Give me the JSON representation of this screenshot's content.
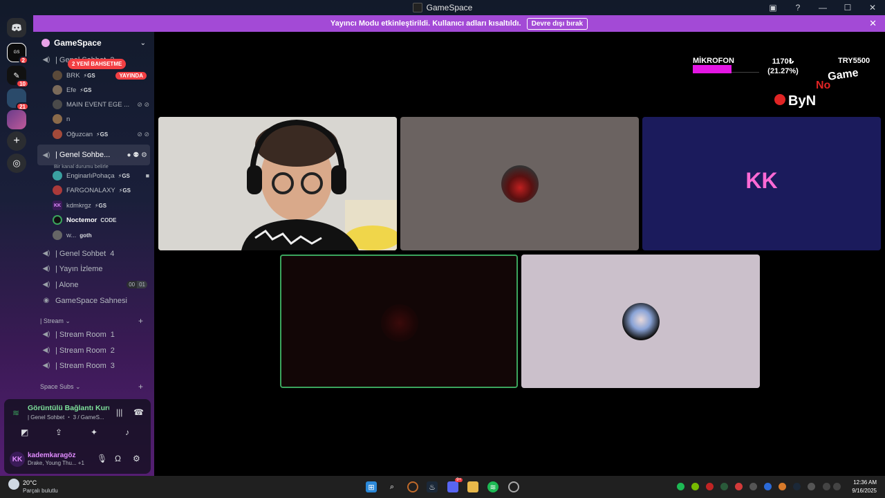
{
  "window": {
    "title": "GameSpace"
  },
  "banner": {
    "text": "Yayıncı Modu etkinleştirildi. Kullanıcı adları kısaltıldı.",
    "button": "Devre dışı bırak"
  },
  "rail": {
    "badges": [
      "2",
      "10",
      "21"
    ]
  },
  "server": {
    "name": "GameSpace"
  },
  "channels": {
    "voice_top_name": "| Genel Sohbet",
    "voice_top_count": "2",
    "mention_pill": "2 YENİ BAHSETME",
    "top_members": [
      {
        "name": "BRK",
        "tag": "⚡GS",
        "live": "YAYINDA"
      },
      {
        "name": "Efe",
        "tag": "⚡GS"
      },
      {
        "name": "MAIN EVENT EGE ...",
        "tag": ""
      },
      {
        "name": "n",
        "tag": ""
      },
      {
        "name": "Oğuzcan",
        "tag": "⚡GS"
      }
    ],
    "active_name": "| Genel Sohbe...",
    "active_status": "Bir kanal durumu belirle",
    "active_members": [
      {
        "name": "EnginarlıPohaça",
        "tag": "⚡GS"
      },
      {
        "name": "FARGONALAXY",
        "tag": "⚡GS"
      },
      {
        "name": "kdmkrgz",
        "tag": "⚡GS"
      },
      {
        "name": "Noctemor",
        "tag": "CODE"
      },
      {
        "name": "w...",
        "tag": "goth"
      }
    ],
    "list": [
      {
        "name": "| Genel Sohbet",
        "count": "4"
      },
      {
        "name": "| Yayın İzleme",
        "count": ""
      },
      {
        "name": "| Alone",
        "count": ""
      }
    ],
    "alone_counters": [
      "00",
      "01"
    ],
    "stage_name": "GameSpace Sahnesi",
    "category_stream": "| Stream",
    "stream_rooms": [
      {
        "name": "| Stream Room",
        "count": "1"
      },
      {
        "name": "| Stream Room",
        "count": "2"
      },
      {
        "name": "| Stream Room",
        "count": "3"
      }
    ],
    "category_subs": "Space Subs"
  },
  "voice_panel": {
    "status": "Görüntülü Bağlantı Kuruldu",
    "sub": "| Genel Sohbet ・ 3 / GameS...",
    "user_initials": "KK",
    "user_name": "kademkaragöz",
    "activity": "Drake, Young Thu... +1"
  },
  "tiles": {
    "kk_initials": "KK"
  },
  "overlay": {
    "mic_label": "MİKROFON",
    "mic_level": 0.56,
    "goal": "1170₺",
    "goal_percent": "(21.27%)",
    "code": "TRY5500",
    "logo": "ByN No Game"
  },
  "taskbar": {
    "temp": "20°C",
    "condition": "Parçalı bulutlu",
    "time": "12:36 AM",
    "date": "9/16/2025",
    "discord_badge": "9+"
  },
  "colors": {
    "accent": "#a34ad6",
    "live": "#f23f43",
    "speaking": "#7ee39b",
    "mic": "#e416e4"
  }
}
